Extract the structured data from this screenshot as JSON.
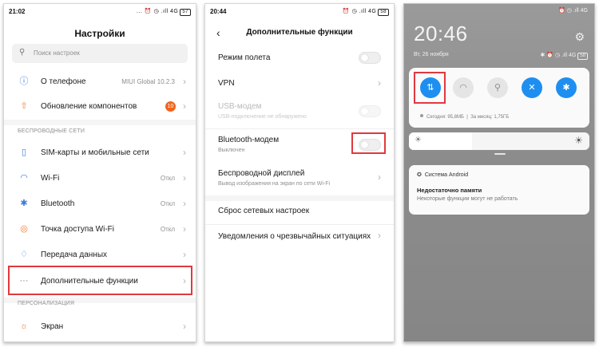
{
  "phone1": {
    "status": {
      "time": "21:02",
      "icons": "... ⏰ ◷ .ıll 4G",
      "battery": "57"
    },
    "title": "Настройки",
    "search": {
      "icon": "search-icon",
      "placeholder": "Поиск настроек"
    },
    "rows_top": [
      {
        "icon": "info-icon",
        "label": "О телефоне",
        "value": "MIUI Global 10.2.3"
      },
      {
        "icon": "update-arrow-icon",
        "label": "Обновление компонентов",
        "badge": "10"
      }
    ],
    "section_wireless": "БЕСПРОВОДНЫЕ СЕТИ",
    "rows_wireless": [
      {
        "icon": "sim-card-icon",
        "label": "SIM-карты и мобильные сети",
        "value": ""
      },
      {
        "icon": "wifi-icon",
        "label": "Wi-Fi",
        "value": "Откл"
      },
      {
        "icon": "bluetooth-icon",
        "label": "Bluetooth",
        "value": "Откл"
      },
      {
        "icon": "hotspot-icon",
        "label": "Точка доступа Wi-Fi",
        "value": "Откл"
      },
      {
        "icon": "data-transfer-icon",
        "label": "Передача данных",
        "value": ""
      },
      {
        "icon": "more-dots-icon",
        "label": "Дополнительные функции",
        "value": ""
      }
    ],
    "section_personal": "ПЕРСОНАЛИЗАЦИЯ",
    "rows_personal": [
      {
        "icon": "brightness-icon",
        "label": "Экран",
        "value": ""
      }
    ]
  },
  "phone2": {
    "status": {
      "time": "20:44",
      "icons": "⏰ ◷ .ıll 4G",
      "battery": "58"
    },
    "title": "Дополнительные функции",
    "rows": [
      {
        "label": "Режим полета",
        "sub": "",
        "control": "toggle",
        "state": "off"
      },
      {
        "label": "VPN",
        "sub": "",
        "control": "chevron"
      },
      {
        "label": "USB-модем",
        "sub": "USB-подключение не обнаружено",
        "control": "toggle",
        "state": "disabled"
      },
      {
        "label": "Bluetooth-модем",
        "sub": "Выключен",
        "control": "toggle",
        "state": "off"
      },
      {
        "label": "Беспроводной дисплей",
        "sub": "Вывод изображения на экран по сети Wi-Fi",
        "control": "chevron"
      },
      {
        "label": "Сброс сетевых настроек",
        "sub": "",
        "control": "none"
      },
      {
        "label": "Уведомления о чрезвычайных ситуациях",
        "sub": "",
        "control": "chevron"
      }
    ]
  },
  "phone3": {
    "status_icons": "⏰ ◷ .ıll 4G",
    "time": "20:46",
    "date": "Вт, 26 ноября",
    "date_icons": "✱ ⏰ ◷ .ıll 4G",
    "battery": "58",
    "quick_toggles": [
      {
        "icon": "mobile-data-icon",
        "state": "on",
        "glyph": "⇅"
      },
      {
        "icon": "wifi-icon",
        "state": "off",
        "glyph": "◠"
      },
      {
        "icon": "flashlight-icon",
        "state": "off",
        "glyph": "⚲"
      },
      {
        "icon": "silent-bell-icon",
        "state": "on",
        "glyph": "🔕"
      },
      {
        "icon": "bluetooth-icon",
        "state": "on",
        "glyph": "✱"
      }
    ],
    "usage_today": "Сегодня: 95,8МБ",
    "usage_separator": "|",
    "usage_month": "За месяц: 1,75ГБ",
    "brightness_level": 0.35,
    "notification": {
      "app": "Система Android",
      "title": "Недостаточно памяти",
      "text": "Некоторые функции могут не работать"
    }
  },
  "colors": {
    "accent_blue": "#1e8ff0",
    "highlight_red": "#e0393e",
    "badge_orange": "#f0651e"
  }
}
